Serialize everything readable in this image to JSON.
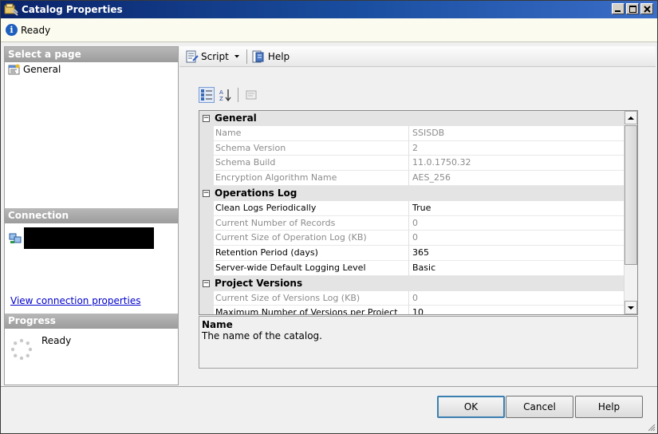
{
  "window": {
    "title": "Catalog Properties",
    "controls": [
      "minimize",
      "maximize",
      "close"
    ]
  },
  "status": {
    "text": "Ready",
    "icon": "info-icon"
  },
  "left": {
    "select_page_header": "Select a page",
    "pages": [
      {
        "label": "General",
        "icon": "properties-page-icon"
      }
    ],
    "connection_header": "Connection",
    "connection_link": "View connection properties",
    "progress_header": "Progress",
    "progress_status": "Ready"
  },
  "toolbar": {
    "script_label": "Script",
    "help_label": "Help"
  },
  "grid": {
    "categories": [
      {
        "label": "General",
        "rows": [
          {
            "name": "Name",
            "value": "SSISDB",
            "readonly": true
          },
          {
            "name": "Schema Version",
            "value": "2",
            "readonly": true
          },
          {
            "name": "Schema Build",
            "value": "11.0.1750.32",
            "readonly": true
          },
          {
            "name": "Encryption Algorithm Name",
            "value": "AES_256",
            "readonly": true
          }
        ]
      },
      {
        "label": "Operations Log",
        "rows": [
          {
            "name": "Clean Logs Periodically",
            "value": "True",
            "readonly": false
          },
          {
            "name": "Current Number of Records",
            "value": "0",
            "readonly": true
          },
          {
            "name": "Current Size of Operation Log (KB)",
            "value": "0",
            "readonly": true
          },
          {
            "name": "Retention Period (days)",
            "value": "365",
            "readonly": false
          },
          {
            "name": "Server-wide Default Logging Level",
            "value": "Basic",
            "readonly": false
          }
        ]
      },
      {
        "label": "Project Versions",
        "rows": [
          {
            "name": "Current Size of Versions Log (KB)",
            "value": "0",
            "readonly": true
          },
          {
            "name": "Maximum Number of Versions per Project",
            "value": "10",
            "readonly": false
          }
        ]
      }
    ]
  },
  "description": {
    "title": "Name",
    "text": "The name of the catalog."
  },
  "buttons": {
    "ok": "OK",
    "cancel": "Cancel",
    "help": "Help"
  },
  "colors": {
    "title_bar": "#0a246a",
    "link": "#0000cc",
    "readonly_text": "#8c8c8c",
    "status_bg": "#fbfbef"
  }
}
